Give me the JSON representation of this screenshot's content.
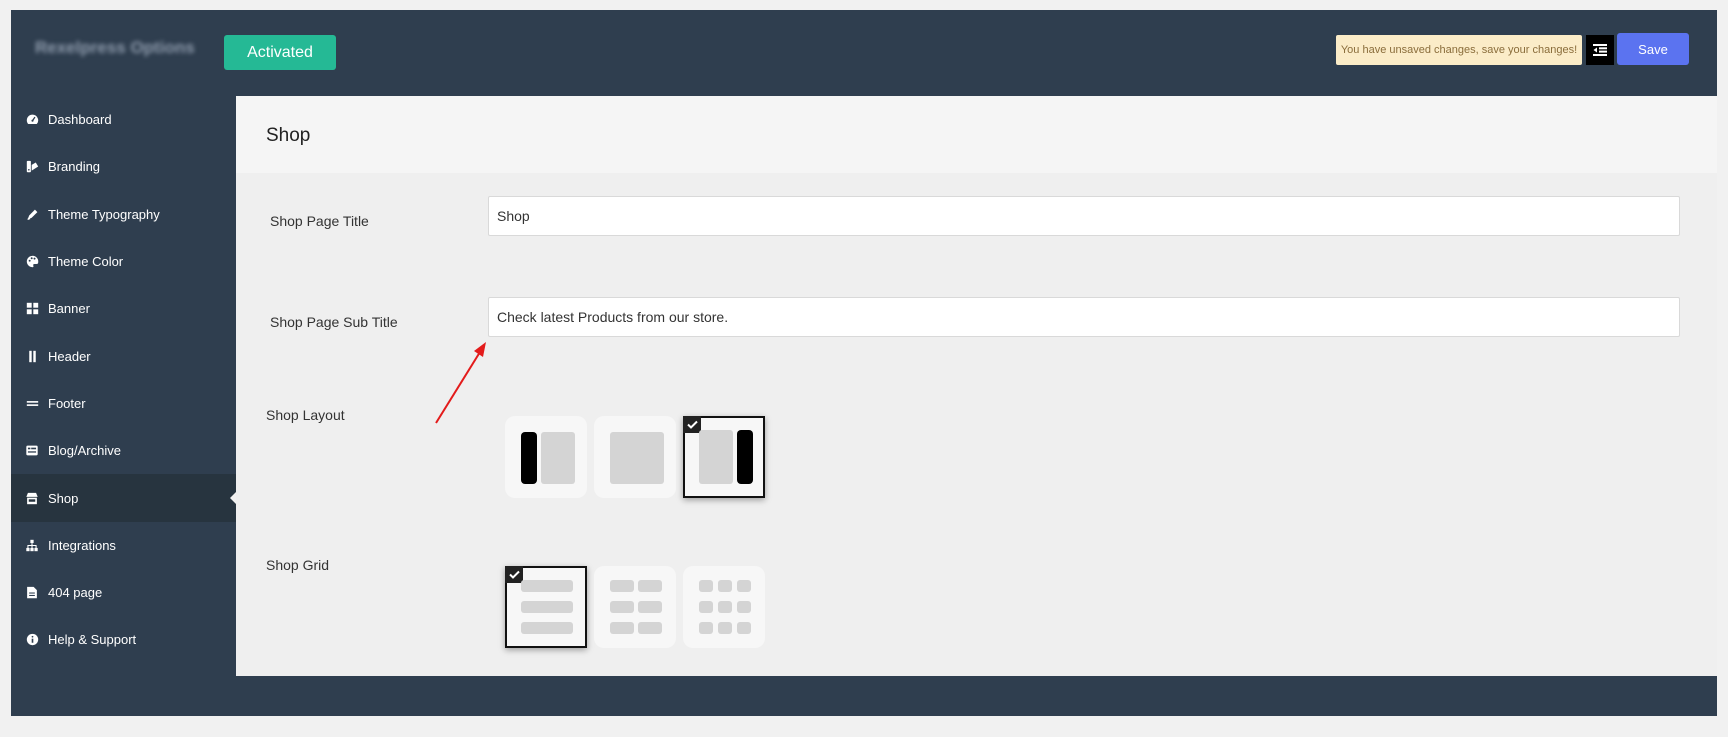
{
  "header": {
    "brand": "Rexelpress Options",
    "activated_label": "Activated",
    "notice": "You have unsaved changes, save your changes!",
    "save_label": "Save",
    "colors": {
      "accent_green": "#25b995",
      "save_blue": "#5b73f0",
      "notice_bg": "#fbecc8",
      "frame_bg": "#2f3e4f"
    }
  },
  "sidebar": {
    "items": [
      {
        "label": "Dashboard",
        "icon": "dashboard-icon"
      },
      {
        "label": "Branding",
        "icon": "branding-icon"
      },
      {
        "label": "Theme Typography",
        "icon": "pen-icon"
      },
      {
        "label": "Theme Color",
        "icon": "palette-icon"
      },
      {
        "label": "Banner",
        "icon": "grid-icon"
      },
      {
        "label": "Header",
        "icon": "header-icon"
      },
      {
        "label": "Footer",
        "icon": "footer-icon"
      },
      {
        "label": "Blog/Archive",
        "icon": "list-icon"
      },
      {
        "label": "Shop",
        "icon": "store-icon",
        "active": true
      },
      {
        "label": "Integrations",
        "icon": "sitemap-icon"
      },
      {
        "label": "404 page",
        "icon": "file-icon"
      },
      {
        "label": "Help & Support",
        "icon": "info-icon"
      }
    ]
  },
  "main": {
    "title": "Shop",
    "fields": {
      "shop_page_title": {
        "label": "Shop Page Title",
        "value": "Shop"
      },
      "shop_page_subtitle": {
        "label": "Shop Page Sub Title",
        "value": "Check latest Products from our store."
      }
    },
    "shop_layout": {
      "label": "Shop Layout",
      "options": [
        "left-sidebar",
        "no-sidebar",
        "right-sidebar"
      ],
      "selected": "right-sidebar"
    },
    "shop_grid": {
      "label": "Shop Grid",
      "options": [
        "1-column",
        "2-columns",
        "3-columns"
      ],
      "selected": "1-column"
    }
  }
}
